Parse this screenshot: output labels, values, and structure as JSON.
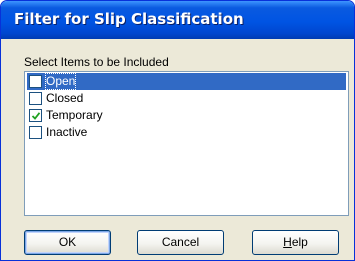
{
  "dialog": {
    "title": "Filter for Slip Classification",
    "instruction": "Select Items to be Included"
  },
  "items": [
    {
      "label": "Open",
      "checked": false,
      "selected": true
    },
    {
      "label": "Closed",
      "checked": false,
      "selected": false
    },
    {
      "label": "Temporary",
      "checked": true,
      "selected": false
    },
    {
      "label": "Inactive",
      "checked": false,
      "selected": false
    }
  ],
  "buttons": {
    "ok_label": "OK",
    "cancel_label": "Cancel",
    "help_mnemonic": "H",
    "help_rest": "elp"
  },
  "colors": {
    "title_bar": "#0054e3",
    "selection": "#316ac5",
    "dialog_face": "#ece9d8"
  },
  "icons": {
    "check": "checkmark-icon"
  }
}
